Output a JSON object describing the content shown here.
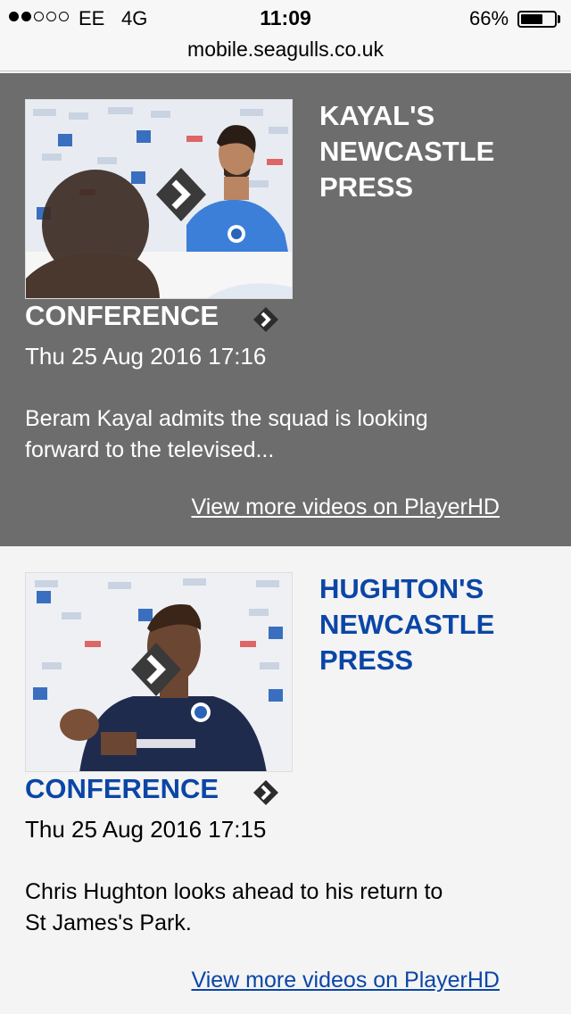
{
  "status_bar": {
    "carrier": "EE",
    "network": "4G",
    "time": "11:09",
    "battery": "66%",
    "battery_level": 0.66,
    "signal_bars_filled": 2,
    "signal_bars_total": 5
  },
  "browser": {
    "url": "mobile.seagulls.co.uk"
  },
  "videos": [
    {
      "title_line1": "KAYAL'S",
      "title_line2": "NEWCASTLE",
      "title_line3": "PRESS",
      "title_line4": "CONFERENCE",
      "date": "Thu 25 Aug 2016 17:16",
      "description_line1": "Beram Kayal admits the squad is looking",
      "description_line2": "forward to the televised...",
      "more_link": "View more videos on PlayerHD",
      "thumbnail_icon": "play-chevron-icon"
    },
    {
      "title_line1": "HUGHTON'S",
      "title_line2": "NEWCASTLE",
      "title_line3": "PRESS",
      "title_line4": "CONFERENCE",
      "date": "Thu 25 Aug 2016 17:15",
      "description_line1": "Chris Hughton looks ahead to his return to",
      "description_line2": "St James's Park.",
      "more_link": "View more videos on PlayerHD",
      "thumbnail_icon": "play-chevron-icon"
    }
  ],
  "colors": {
    "dark_card": "#6d6d6d",
    "light_card": "#f4f4f4",
    "title_blue": "#0b46a6"
  }
}
